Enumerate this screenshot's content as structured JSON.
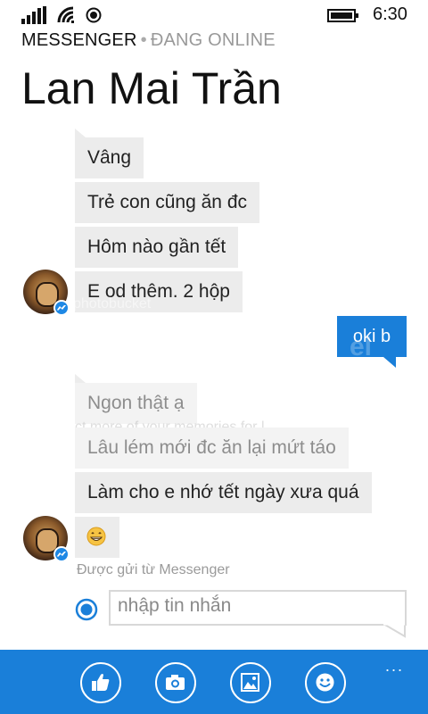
{
  "status_bar": {
    "time": "6:30"
  },
  "header": {
    "app_name": "MESSENGER",
    "separator": "•",
    "presence": "ĐANG ONLINE",
    "contact_name": "Lan Mai Trần"
  },
  "messages": {
    "incoming_group1": [
      "Vâng",
      "Trẻ con cũng ăn đc",
      "Hôm nào gần tết",
      "E od thêm. 2 hộp"
    ],
    "outgoing": "oki b",
    "incoming_group2": [
      "Ngon thật ạ",
      "Lâu lém mới đc ăn lại mứt táo",
      "Làm cho e nhớ tết ngày xưa quá"
    ],
    "emoji": "grinning-face"
  },
  "sent_from": "Được gửi từ Messenger",
  "composer": {
    "placeholder": "nhập tin nhắn"
  },
  "app_bar": {
    "more": "...",
    "buttons": [
      "like-icon",
      "camera-icon",
      "photo-icon",
      "emoji-icon"
    ]
  },
  "watermark": [
    "photobucket",
    "el",
    "ct more of your memories for l"
  ],
  "colors": {
    "accent": "#1a7fd9",
    "bubble_in": "#ececec"
  }
}
